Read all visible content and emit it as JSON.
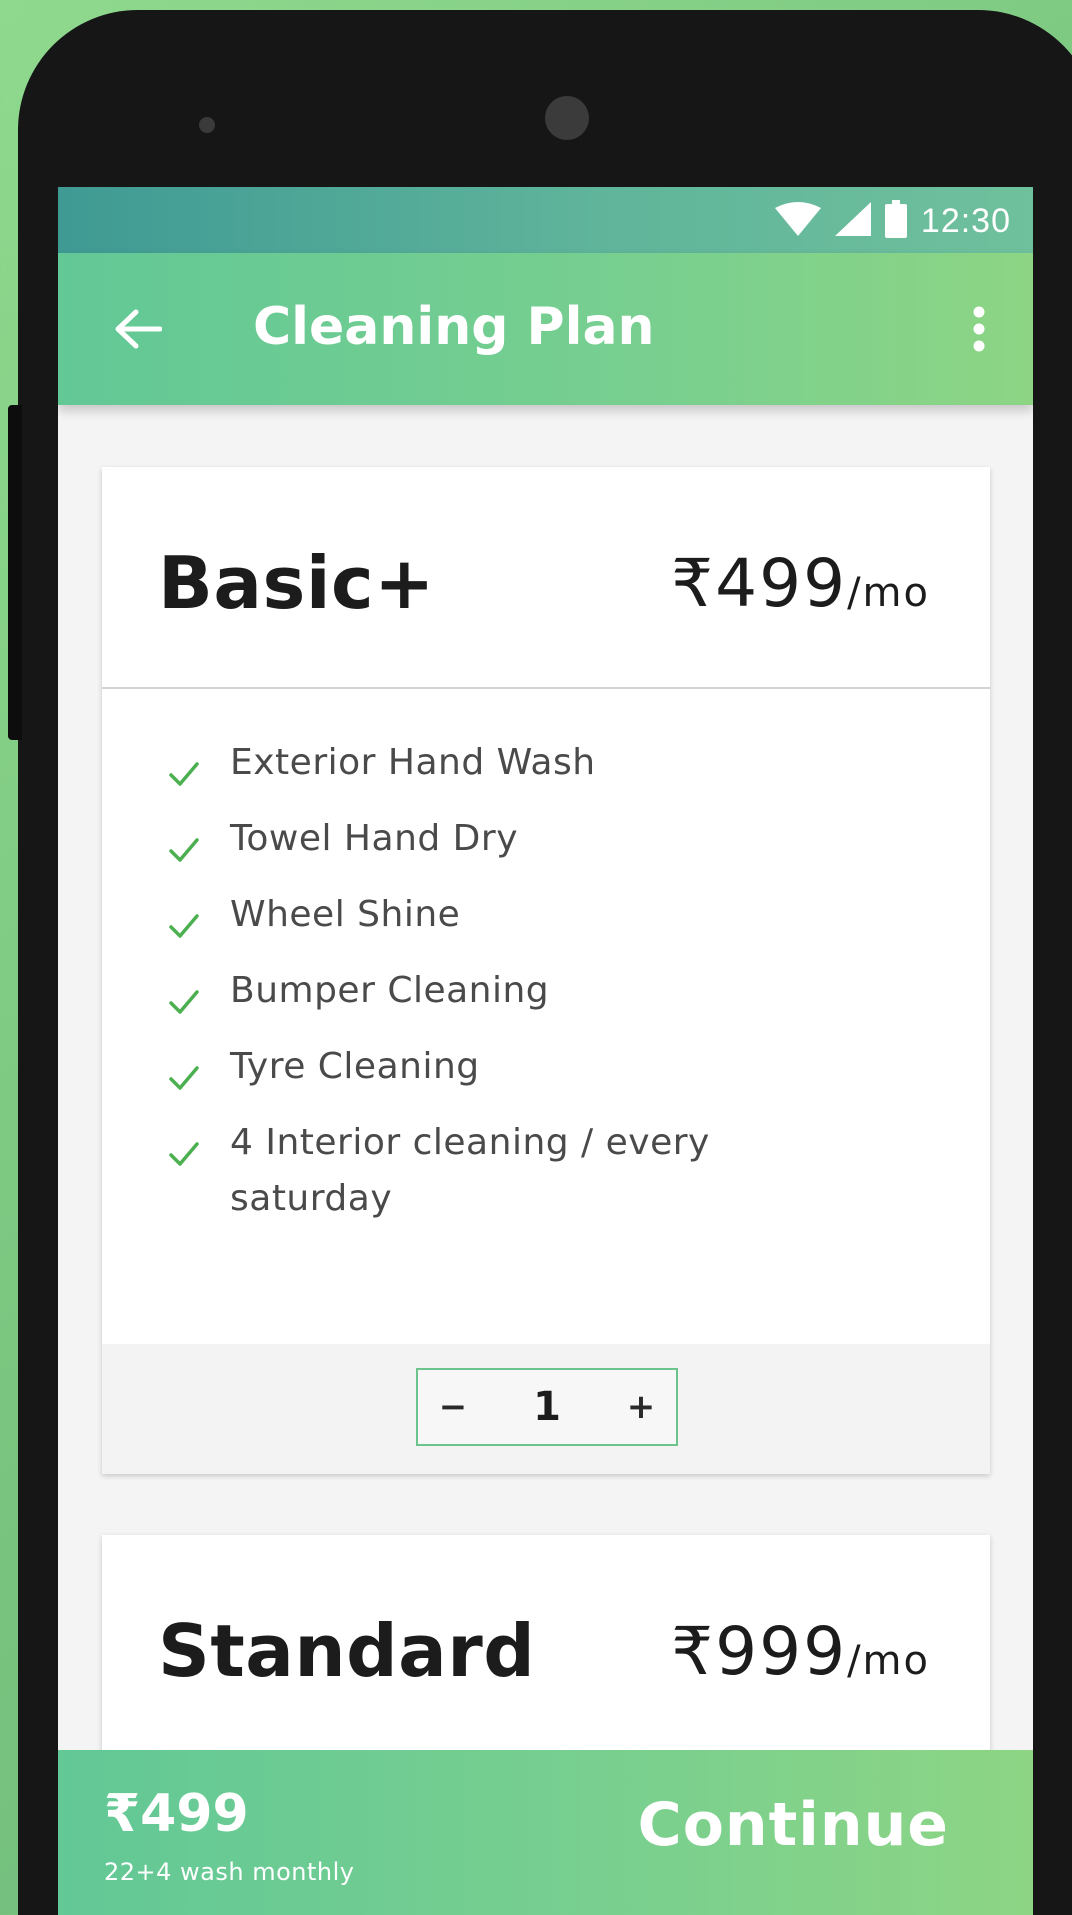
{
  "status_bar": {
    "time": "12:30",
    "icons": [
      "wifi-icon",
      "signal-icon",
      "battery-icon"
    ]
  },
  "app_bar": {
    "title": "Cleaning Plan",
    "back_icon": "arrow-left-icon",
    "menu_icon": "more-vertical-icon"
  },
  "plans": [
    {
      "name": "Basic+",
      "price": "₹499",
      "period": "/mo",
      "features": [
        "Exterior Hand Wash",
        "Towel Hand Dry",
        "Wheel Shine",
        "Bumper Cleaning",
        "Tyre Cleaning",
        "4 Interior cleaning / every saturday"
      ],
      "quantity": {
        "decrement_label": "−",
        "value": "1",
        "increment_label": "+"
      }
    },
    {
      "name": "Standard",
      "price": "₹999",
      "period": "/mo"
    }
  ],
  "footer": {
    "total_price": "₹499",
    "subtitle": "22+4 wash monthly",
    "continue_label": "Continue"
  },
  "colors": {
    "accent_green": "#6cc48c",
    "check_green": "#4caf50",
    "app_bar_start": "#62c896",
    "app_bar_end": "#8dd585",
    "status_bar": "#4fa898",
    "text_dark": "#1c1c1c"
  }
}
